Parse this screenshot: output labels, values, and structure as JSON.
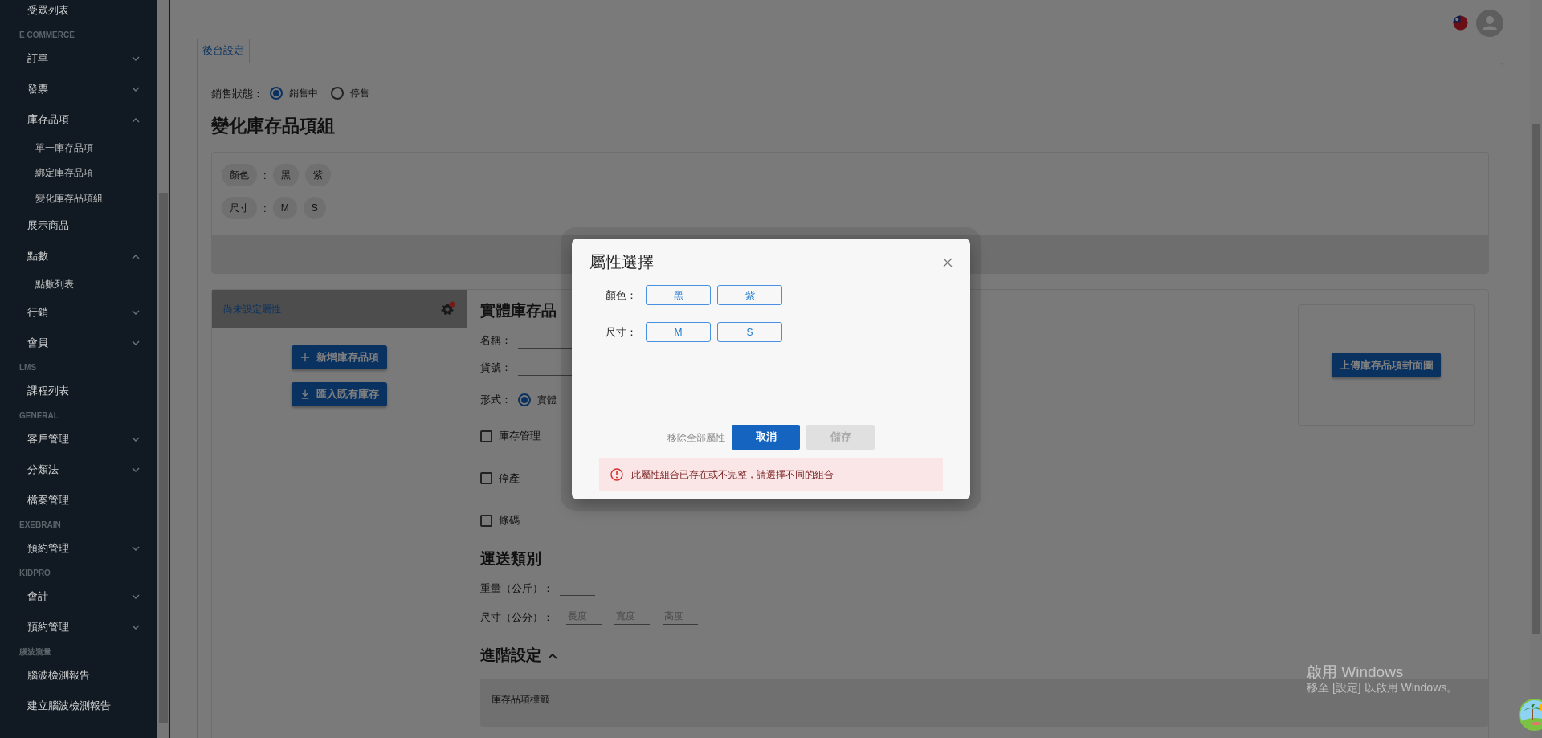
{
  "sidebar": {
    "items": [
      {
        "kind": "item",
        "label": "受眾列表"
      },
      {
        "kind": "section",
        "label": "E COMMERCE"
      },
      {
        "kind": "item",
        "label": "訂單",
        "expanded": false
      },
      {
        "kind": "item",
        "label": "發票",
        "expanded": false
      },
      {
        "kind": "item",
        "label": "庫存品項",
        "expanded": true
      },
      {
        "kind": "subitem",
        "label": "單一庫存品項"
      },
      {
        "kind": "subitem",
        "label": "綁定庫存品項"
      },
      {
        "kind": "subitem",
        "label": "變化庫存品項組"
      },
      {
        "kind": "item",
        "label": "展示商品"
      },
      {
        "kind": "item",
        "label": "點數",
        "expanded": true
      },
      {
        "kind": "subitem",
        "label": "點數列表"
      },
      {
        "kind": "item",
        "label": "行銷",
        "expanded": false
      },
      {
        "kind": "item",
        "label": "會員",
        "expanded": false
      },
      {
        "kind": "section",
        "label": "LMS"
      },
      {
        "kind": "item",
        "label": "課程列表"
      },
      {
        "kind": "section",
        "label": "GENERAL"
      },
      {
        "kind": "item",
        "label": "客戶管理",
        "expanded": false
      },
      {
        "kind": "item",
        "label": "分類法",
        "expanded": false
      },
      {
        "kind": "item",
        "label": "檔案管理"
      },
      {
        "kind": "section",
        "label": "EXEBRAIN"
      },
      {
        "kind": "item",
        "label": "預約管理",
        "expanded": false
      },
      {
        "kind": "section",
        "label": "KIDPRO"
      },
      {
        "kind": "item",
        "label": "會計",
        "expanded": false
      },
      {
        "kind": "item",
        "label": "預約管理",
        "expanded": false
      },
      {
        "kind": "section",
        "label": "腦波測量"
      },
      {
        "kind": "item",
        "label": "腦波檢測報告"
      },
      {
        "kind": "item",
        "label": "建立腦波檢測報告"
      }
    ]
  },
  "tabs": [
    {
      "label": "後台設定",
      "selected": true
    }
  ],
  "sale_status": {
    "label": "銷售狀態：",
    "options": [
      {
        "label": "銷售中",
        "selected": true
      },
      {
        "label": "停售",
        "selected": false
      }
    ]
  },
  "heading": "變化庫存品項組",
  "attributes": [
    {
      "name": "顏色",
      "separator": ":",
      "values": [
        "黑",
        "紫"
      ]
    },
    {
      "name": "尺寸",
      "separator": ":",
      "values": [
        "M",
        "S"
      ]
    }
  ],
  "variant_list": {
    "header": "尚未設定屬性",
    "alert": true,
    "buttons": [
      {
        "label": "新增庫存品項"
      },
      {
        "label": "匯入既有庫存"
      }
    ]
  },
  "item_form": {
    "title": "實體庫存品",
    "fields": [
      {
        "label": "名稱："
      },
      {
        "label": "貨號："
      }
    ],
    "form_type": {
      "label": "形式：",
      "options": [
        {
          "label": "實體",
          "selected": true
        }
      ]
    },
    "checkboxes": [
      {
        "label": "庫存管理",
        "checked": false
      },
      {
        "label": "停產",
        "checked": false
      },
      {
        "label": "條碼",
        "checked": false
      }
    ]
  },
  "cover": {
    "button": "上傳庫存品項封面圖"
  },
  "shipping": {
    "title": "運送類別",
    "weight_label": "重量（公斤）：",
    "size_label": "尺寸（公分）：",
    "size_placeholders": [
      "長度",
      "寬度",
      "高度"
    ]
  },
  "advanced": {
    "title": "進階設定",
    "expanded": true,
    "tags_label": "庫存品項標籤"
  },
  "modal": {
    "title": "屬性選擇",
    "groups": [
      {
        "label": "顏色：",
        "options": [
          {
            "label": "黑",
            "selected": false
          },
          {
            "label": "紫",
            "selected": false
          }
        ]
      },
      {
        "label": "尺寸：",
        "options": [
          {
            "label": "M",
            "selected": false
          },
          {
            "label": "S",
            "selected": false
          }
        ]
      }
    ],
    "remove_all": "移除全部屬性",
    "cancel": "取消",
    "save": {
      "label": "儲存",
      "disabled": true
    },
    "alert": "此屬性組合已存在或不完整，請選擇不同的組合"
  },
  "windows_notice": [
    "啟用 Windows",
    "移至 [設定] 以啟用 Windows。"
  ]
}
